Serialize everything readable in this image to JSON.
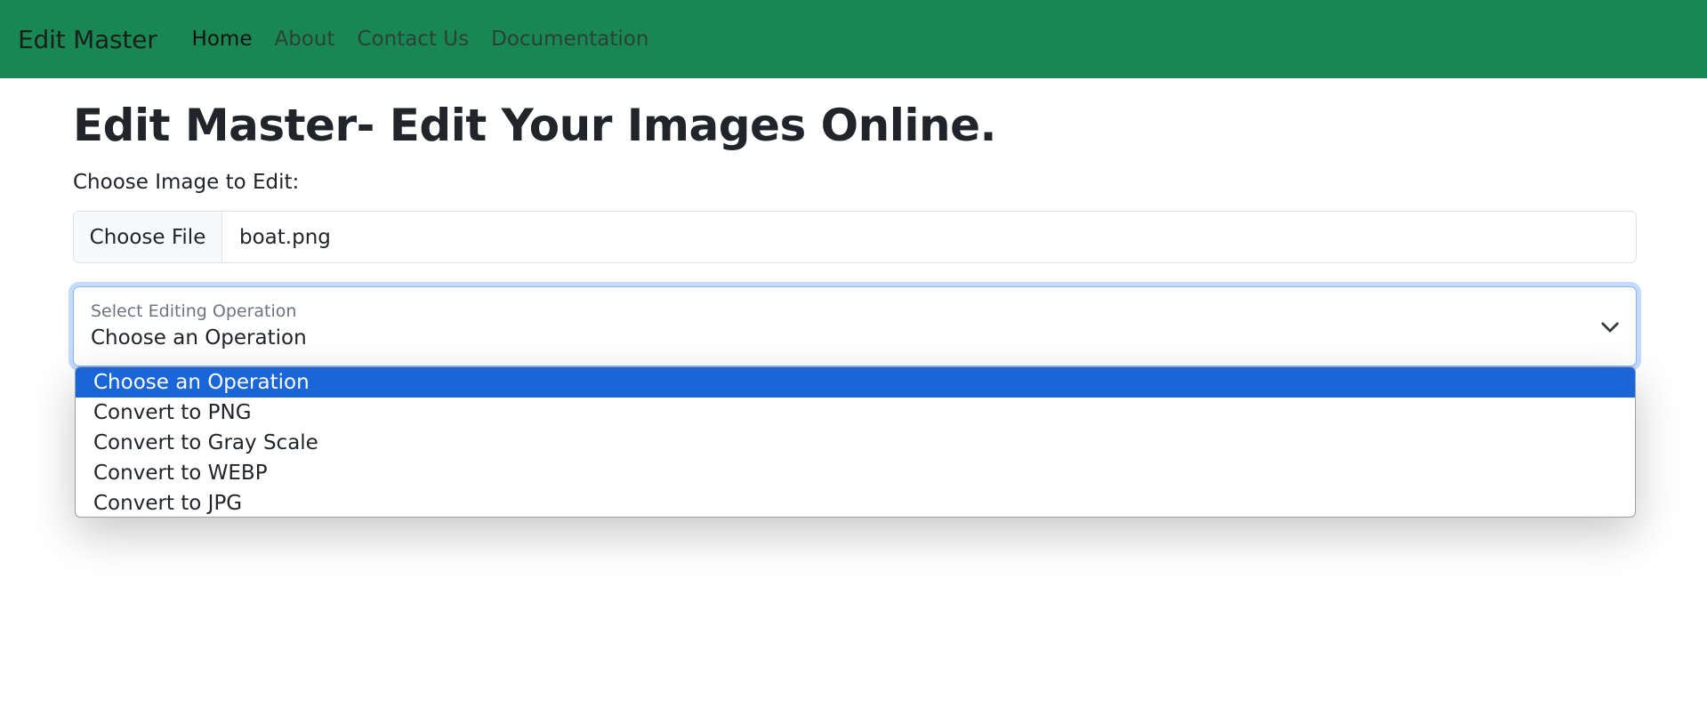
{
  "navbar": {
    "brand": "Edit Master",
    "links": [
      "Home",
      "About",
      "Contact Us",
      "Documentation"
    ],
    "background": "#198754"
  },
  "main": {
    "title": "Edit Master- Edit Your Images Online.",
    "file_label": "Choose Image to Edit:",
    "file_button": "Choose File",
    "file_name": "boat.png",
    "select_label": "Select Editing Operation",
    "select_value": "Choose an Operation",
    "options": [
      "Choose an Operation",
      "Convert to PNG",
      "Convert to Gray Scale",
      "Convert to WEBP",
      "Convert to JPG"
    ],
    "selected_color": "#1a66d8"
  }
}
